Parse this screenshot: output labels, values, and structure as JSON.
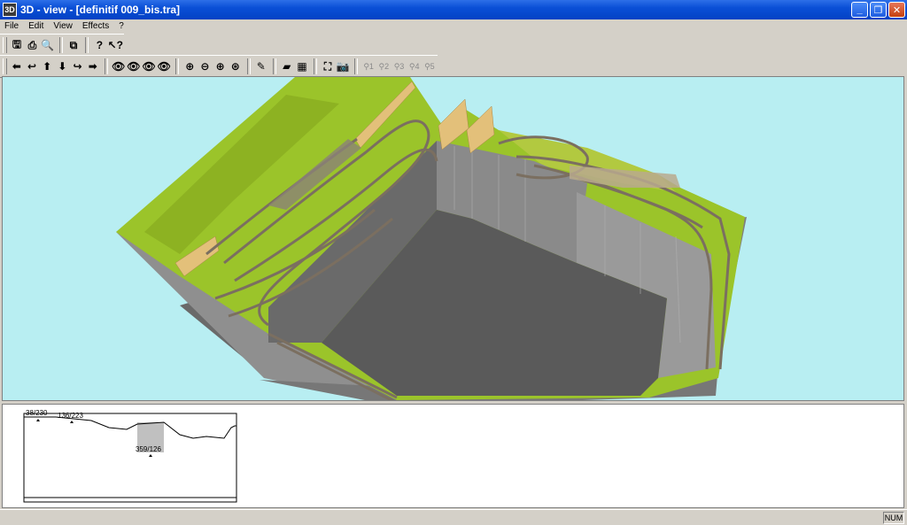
{
  "window": {
    "title": "3D - view - [definitif 009_bis.tra]",
    "icon_label": "3D",
    "minimize": "_",
    "maximize": "❐",
    "close": "✕"
  },
  "menu": [
    {
      "id": "file",
      "label": "File"
    },
    {
      "id": "edit",
      "label": "Edit"
    },
    {
      "id": "view",
      "label": "View"
    },
    {
      "id": "effects",
      "label": "Effects"
    },
    {
      "id": "help",
      "label": "?"
    }
  ],
  "toolbar1": [
    {
      "id": "save",
      "icon": "save-icon",
      "glyph": "🖫"
    },
    {
      "id": "print",
      "icon": "print-icon",
      "glyph": "⎙"
    },
    {
      "id": "print-preview",
      "icon": "print-preview-icon",
      "glyph": "🔍"
    },
    {
      "id": "copy",
      "icon": "copy-icon",
      "glyph": "⧉"
    },
    {
      "id": "help",
      "icon": "help-icon",
      "glyph": "?"
    },
    {
      "id": "context-help",
      "icon": "context-help-icon",
      "glyph": "↖?"
    }
  ],
  "toolbar2": {
    "nav": [
      {
        "id": "rotate-left",
        "icon": "arrow-left-icon",
        "glyph": "⬅"
      },
      {
        "id": "rotate-back-left",
        "icon": "arrow-curve-left-icon",
        "glyph": "↩"
      },
      {
        "id": "move-up",
        "icon": "arrow-up-icon",
        "glyph": "⬆"
      },
      {
        "id": "move-down",
        "icon": "arrow-down-icon",
        "glyph": "⬇"
      },
      {
        "id": "rotate-back-right",
        "icon": "arrow-curve-right-icon",
        "glyph": "↪"
      },
      {
        "id": "rotate-right",
        "icon": "arrow-right-icon",
        "glyph": "➡"
      }
    ],
    "camera": [
      {
        "id": "eye-1",
        "icon": "eye-view-icon",
        "glyph": "👁"
      },
      {
        "id": "eye-2",
        "icon": "eye-up-icon",
        "glyph": "👁"
      },
      {
        "id": "eye-3",
        "icon": "eye-down-icon",
        "glyph": "👁"
      },
      {
        "id": "eye-4",
        "icon": "eye-reset-icon",
        "glyph": "👁"
      }
    ],
    "zoom": [
      {
        "id": "zoom-in-plus",
        "icon": "zoom-plus-icon",
        "glyph": "⊕"
      },
      {
        "id": "zoom-out",
        "icon": "zoom-out-icon",
        "glyph": "⊖"
      },
      {
        "id": "zoom-in",
        "icon": "zoom-in-icon",
        "glyph": "⊕"
      },
      {
        "id": "zoom-fit",
        "icon": "zoom-fit-icon",
        "glyph": "⊛"
      }
    ],
    "tools": [
      {
        "id": "track-tool",
        "icon": "track-icon",
        "glyph": "✎"
      },
      {
        "id": "terrain",
        "icon": "terrain-icon",
        "glyph": "▰"
      },
      {
        "id": "grid",
        "icon": "grid-icon",
        "glyph": "▦"
      },
      {
        "id": "fit-screen",
        "icon": "fit-screen-icon",
        "glyph": "⛶"
      },
      {
        "id": "camera",
        "icon": "camera-icon",
        "glyph": "📷"
      }
    ],
    "viewpoints": [
      {
        "id": "vp1",
        "icon": "viewpoint-1-icon",
        "label": "1"
      },
      {
        "id": "vp2",
        "icon": "viewpoint-2-icon",
        "label": "2"
      },
      {
        "id": "vp3",
        "icon": "viewpoint-3-icon",
        "label": "3"
      },
      {
        "id": "vp4",
        "icon": "viewpoint-4-icon",
        "label": "4"
      },
      {
        "id": "vp5",
        "icon": "viewpoint-5-icon",
        "label": "5"
      }
    ]
  },
  "colors": {
    "sky": "#b8eef2",
    "grass": "#9bc42a",
    "grass_dark": "#7d9e1a",
    "wall_dark": "#6e6e6e",
    "wall_mid": "#9a9a9a",
    "floor": "#5a5a5a",
    "track": "#8a7a6a",
    "board": "#e3c07a"
  },
  "profile": {
    "labels": [
      "38/230",
      "136/223",
      "359/126"
    ]
  },
  "status": {
    "num": "NUM"
  }
}
